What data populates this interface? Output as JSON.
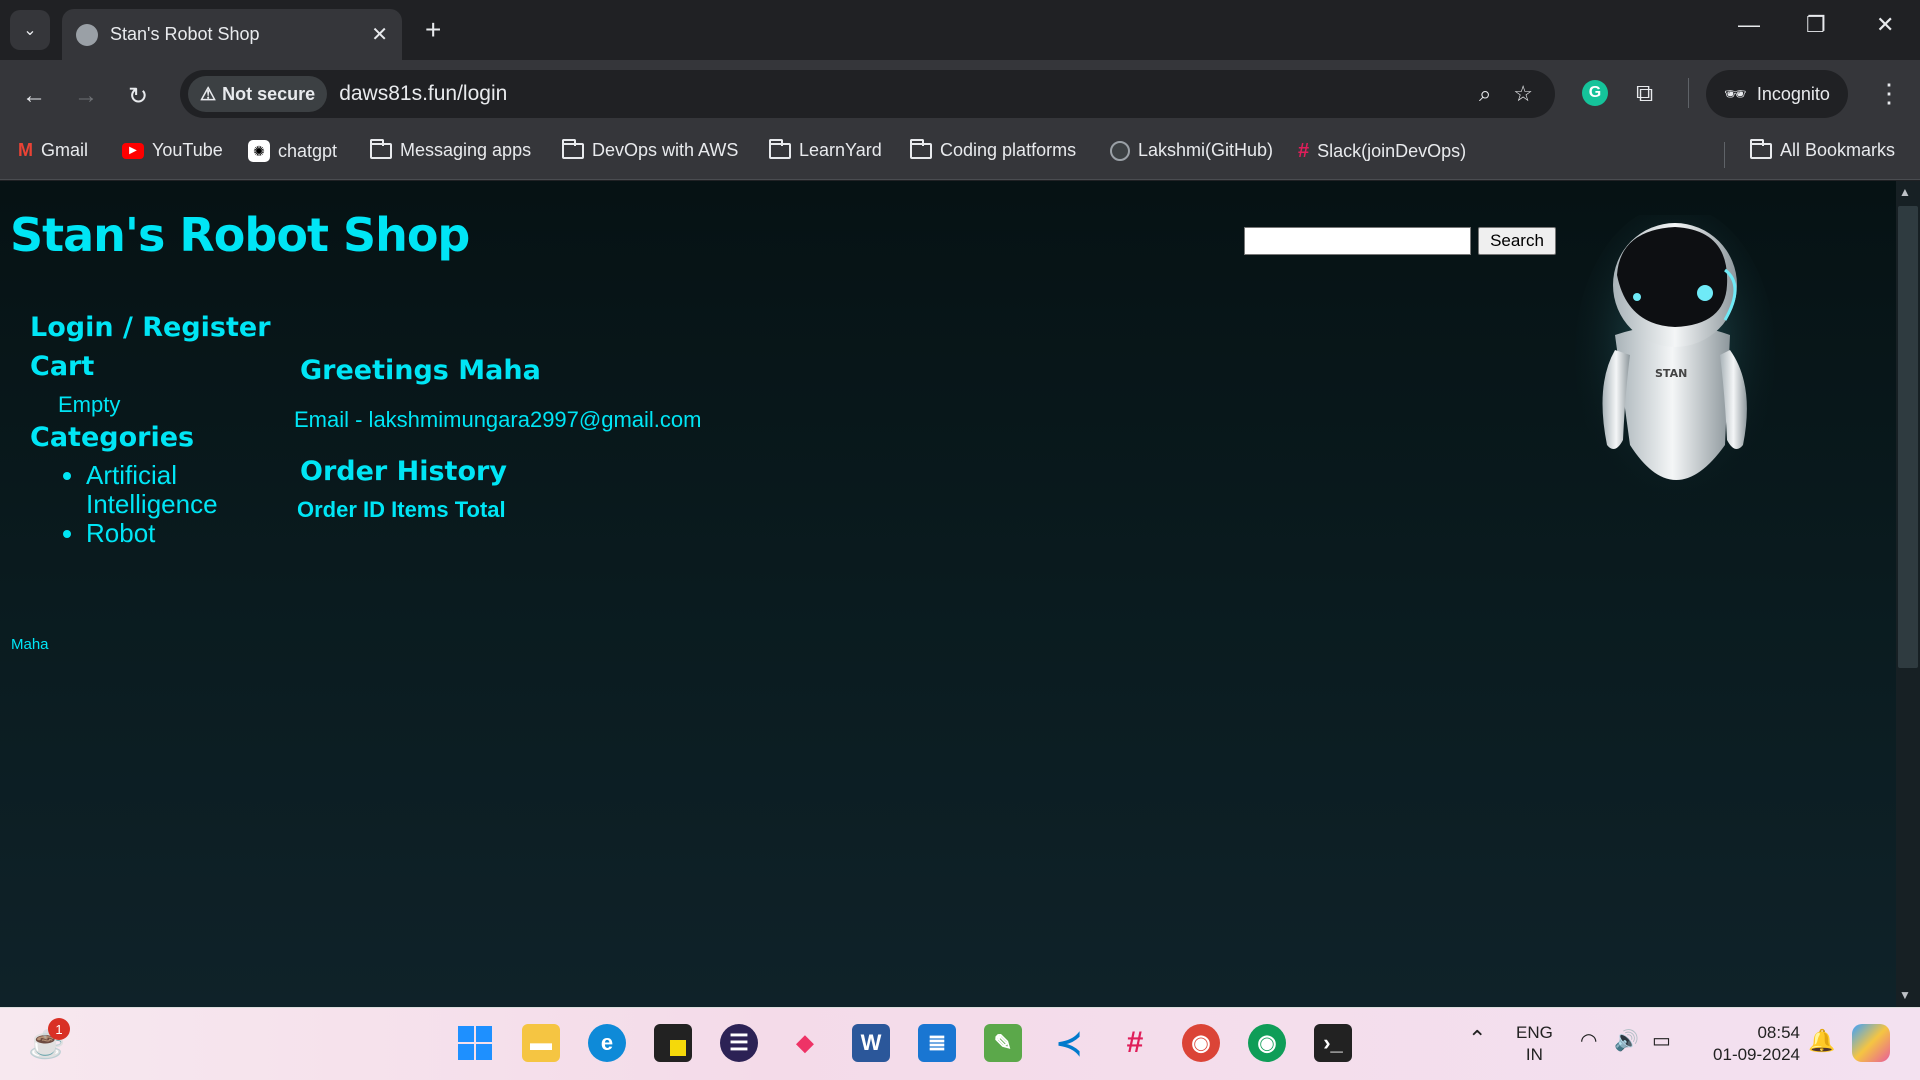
{
  "browser": {
    "tab_title": "Stan's Robot Shop",
    "security_label": "Not secure",
    "url": "daws81s.fun/login",
    "incognito_label": "Incognito"
  },
  "bookmarks": [
    {
      "label": "Gmail",
      "icon": "gmail-icon"
    },
    {
      "label": "YouTube",
      "icon": "youtube-icon"
    },
    {
      "label": "chatgpt",
      "icon": "chatgpt-icon"
    },
    {
      "label": "Messaging apps",
      "icon": "folder-icon"
    },
    {
      "label": "DevOps with AWS",
      "icon": "folder-icon"
    },
    {
      "label": "LearnYard",
      "icon": "folder-icon"
    },
    {
      "label": "Coding platforms",
      "icon": "folder-icon"
    },
    {
      "label": "Lakshmi(GitHub)",
      "icon": "github-icon"
    },
    {
      "label": "Slack(joinDevOps)",
      "icon": "slack-icon"
    }
  ],
  "all_bookmarks": "All Bookmarks",
  "site": {
    "title": "Stan's Robot Shop",
    "search_button": "Search",
    "search_value": "",
    "login_register": "Login / Register",
    "cart": "Cart",
    "cart_status": "Empty",
    "categories": "Categories",
    "category_items": [
      "Artificial Intelligence",
      "Robot"
    ],
    "greeting": "Greetings Maha",
    "email": "Email - lakshmimungara2997@gmail.com",
    "order_history": "Order History",
    "order_columns": "Order ID Items Total",
    "footer_user": "Maha",
    "robot_label": "STAN"
  },
  "taskbar": {
    "notification_count": "1",
    "lang_line1": "ENG",
    "lang_line2": "IN",
    "time": "08:54",
    "date": "01-09-2024"
  },
  "colors": {
    "accent": "#00e5f5",
    "page_bg": "#0a1b1f",
    "browser_chrome": "#35363a"
  }
}
